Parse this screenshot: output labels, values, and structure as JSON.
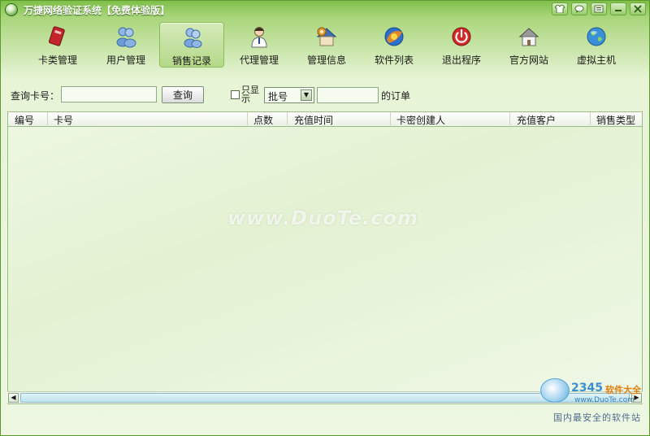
{
  "window": {
    "title": "万捷网络验证系统【免费体验版】",
    "buttons": [
      "shirt-icon",
      "chat-icon",
      "list-icon",
      "minimize-icon",
      "close-icon"
    ]
  },
  "toolbar": {
    "active_index": 2,
    "items": [
      {
        "label": "卡类管理",
        "icon": "card-icon"
      },
      {
        "label": "用户管理",
        "icon": "users-icon"
      },
      {
        "label": "销售记录",
        "icon": "sales-icon"
      },
      {
        "label": "代理管理",
        "icon": "agent-icon"
      },
      {
        "label": "管理信息",
        "icon": "house-gear-icon"
      },
      {
        "label": "软件列表",
        "icon": "software-icon"
      },
      {
        "label": "退出程序",
        "icon": "power-icon"
      },
      {
        "label": "官方网站",
        "icon": "home-icon"
      },
      {
        "label": "虚拟主机",
        "icon": "globe-icon"
      }
    ]
  },
  "search": {
    "card_label": "查询卡号：",
    "card_value": "",
    "query_button": "查询",
    "only_show_label": "只显示",
    "only_show_checked": false,
    "filter_value": "批号",
    "batch_value": "",
    "suffix": "的订单"
  },
  "table": {
    "columns": [
      "编号",
      "卡号",
      "点数",
      "充值时间",
      "卡密创建人",
      "充值客户",
      "销售类型"
    ],
    "rows": []
  },
  "watermark": "www.DuoTe.com",
  "badge": {
    "brand_num": "2345",
    "brand_text": "软件大全",
    "url": "www.DuoTe.com",
    "slogan": "国内最安全的软件站"
  },
  "colors": {
    "accent": "#7fbf4a",
    "active_tab": "#b5d98a"
  }
}
